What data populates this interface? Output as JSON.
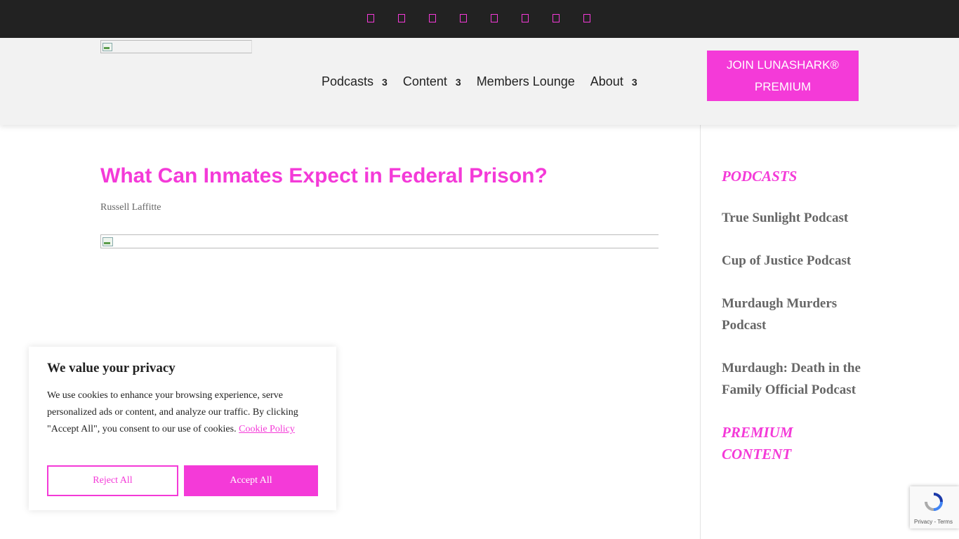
{
  "topbar": {
    "social_icons": [
      "facebook-icon",
      "twitter-icon",
      "instagram-icon",
      "youtube-icon",
      "spotify-icon",
      "apple-podcasts-icon",
      "tiktok-icon",
      "patreon-icon"
    ],
    "icon_color": "#f43ad8"
  },
  "header": {
    "nav": [
      {
        "label": "Podcasts",
        "caret": "3"
      },
      {
        "label": "Content",
        "caret": "3"
      },
      {
        "label": "Members Lounge",
        "caret": ""
      },
      {
        "label": "About",
        "caret": "3"
      }
    ],
    "cta_line1": "JOIN LUNASHARK®",
    "cta_line2": "PREMIUM"
  },
  "post": {
    "title": "What Can Inmates Expect in Federal Prison?",
    "author": "Russell Laffitte"
  },
  "sidebar": {
    "heading_podcasts": "PODCASTS",
    "links": [
      "True Sunlight Podcast",
      "Cup of Justice Podcast",
      "Murdaugh Murders Podcast",
      "Murdaugh: Death in the Family Official Podcast"
    ],
    "heading_premium": "PREMIUM CONTENT"
  },
  "cookie": {
    "title": "We value your privacy",
    "text": "We use cookies to enhance your browsing experience, serve personalized ads or content, and analyze our traffic. By clicking \"Accept All\", you consent to our use of cookies.",
    "policy_link": "Cookie Policy",
    "reject_label": "Reject All",
    "accept_label": "Accept All"
  },
  "recaptcha": {
    "terms": "Privacy - Terms"
  },
  "colors": {
    "accent": "#f43ad8",
    "topbar": "#222222",
    "header_bg": "#f2f2f2"
  }
}
